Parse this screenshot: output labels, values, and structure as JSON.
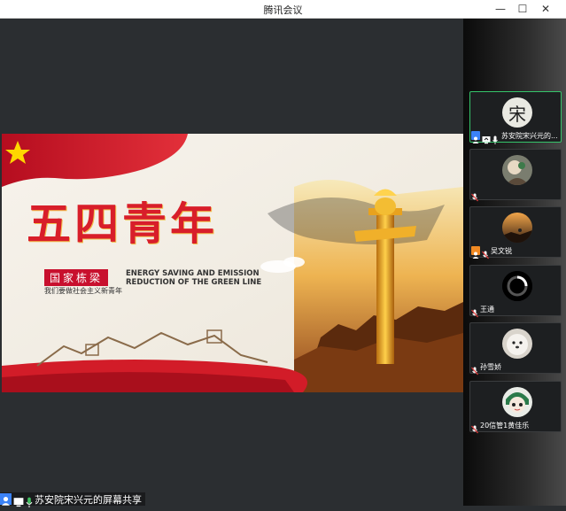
{
  "window": {
    "title": "腾讯会议",
    "minimize": "—",
    "maximize": "☐",
    "close": "✕"
  },
  "share_banner": {
    "headline": "五四青年",
    "badge": "国家栋梁",
    "slogan": "我们要做社会主义新青年",
    "english": [
      "ENERGY SAVING AND EMISSION",
      "REDUCTION OF THE GREEN LINE"
    ],
    "colors": {
      "red": "#c8102e",
      "gold": "#e0a21a"
    }
  },
  "participants": [
    {
      "name": "苏安院宋兴元的...",
      "avatar_text": "宋",
      "active": true,
      "icons": [
        "user-icon",
        "screen-share-icon",
        "mic-icon"
      ]
    },
    {
      "name": "",
      "avatar_text": "",
      "active": false,
      "icons": [
        "mic-muted-icon"
      ]
    },
    {
      "name": "吴文锐",
      "avatar_text": "",
      "active": false,
      "icons": [
        "user-icon",
        "mic-muted-icon"
      ]
    },
    {
      "name": "王通",
      "avatar_text": "",
      "active": false,
      "icons": [
        "mic-muted-icon"
      ]
    },
    {
      "name": "孙雪娇",
      "avatar_text": "",
      "active": false,
      "icons": [
        "mic-muted-icon"
      ]
    },
    {
      "name": "20信管1黄佳乐",
      "avatar_text": "",
      "active": false,
      "icons": [
        "mic-muted-icon"
      ]
    }
  ],
  "bottom_bar": {
    "label": "苏安院宋兴元的屏幕共享"
  }
}
